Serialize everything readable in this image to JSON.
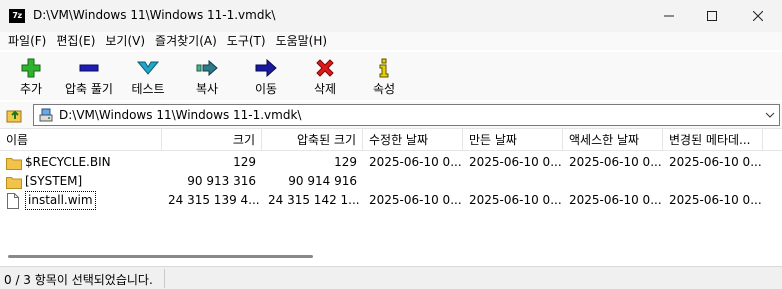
{
  "window": {
    "app_icon_text": "7z",
    "title": "D:\\VM\\Windows 11\\Windows 11-1.vmdk\\",
    "minimize_icon": "minimize-icon",
    "maximize_icon": "maximize-icon",
    "close_icon": "close-icon"
  },
  "menu": [
    {
      "label": "파일(F)"
    },
    {
      "label": "편집(E)"
    },
    {
      "label": "보기(V)"
    },
    {
      "label": "즐겨찾기(A)"
    },
    {
      "label": "도구(T)"
    },
    {
      "label": "도움말(H)"
    }
  ],
  "toolbar": {
    "add": {
      "label": "추가",
      "icon": "plus-icon",
      "color": "#2fb32f"
    },
    "extract": {
      "label": "압축 풀기",
      "icon": "minus-icon",
      "color": "#1e1eb4"
    },
    "test": {
      "label": "테스트",
      "icon": "test-chevron-icon",
      "color": "#22a6c8"
    },
    "copy": {
      "label": "복사",
      "icon": "copy-arrow-icon",
      "color": "#3a8a7a"
    },
    "move": {
      "label": "이동",
      "icon": "move-arrow-icon",
      "color": "#1a1aa0"
    },
    "delete": {
      "label": "삭제",
      "icon": "delete-x-icon",
      "color": "#e01818"
    },
    "info": {
      "label": "속성",
      "icon": "info-icon",
      "color": "#c8b400"
    }
  },
  "address": {
    "path": "D:\\VM\\Windows 11\\Windows 11-1.vmdk\\",
    "up_icon": "up-folder-icon",
    "drive_icon": "drive-icon",
    "dropdown_icon": "chevron-down-icon"
  },
  "columns": {
    "name": "이름",
    "size": "크기",
    "packed_size": "압축된 크기",
    "modified": "수정한 날짜",
    "created": "만든 날짜",
    "accessed": "액세스한 날짜",
    "changed": "변경된 메타데..."
  },
  "files": [
    {
      "name": "$RECYCLE.BIN",
      "type": "folder",
      "size": "129",
      "packed": "129",
      "modified": "2025-06-10 0...",
      "created": "2025-06-10 0...",
      "accessed": "2025-06-10 0...",
      "changed": "2025-06-10 0..."
    },
    {
      "name": "[SYSTEM]",
      "type": "folder",
      "size": "90 913 316",
      "packed": "90 914 916",
      "modified": "",
      "created": "",
      "accessed": "",
      "changed": ""
    },
    {
      "name": "install.wim",
      "type": "file",
      "size": "24 315 139 4...",
      "packed": "24 315 142 1...",
      "modified": "2025-06-10 0...",
      "created": "2025-06-10 0...",
      "accessed": "2025-06-10 0...",
      "changed": "2025-06-10 0..."
    }
  ],
  "status": {
    "selection": "0 / 3 항목이 선택되었습니다."
  }
}
